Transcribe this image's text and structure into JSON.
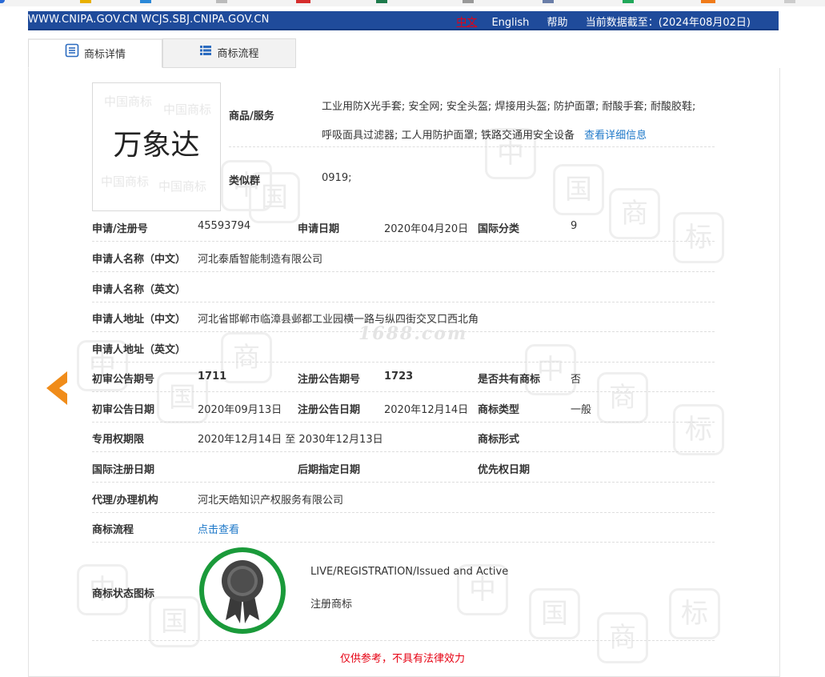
{
  "header": {
    "domains": "WWW.CNIPA.GOV.CN WCJS.SBJ.CNIPA.GOV.CN",
    "lang_zh": "中文",
    "lang_en": "English",
    "help": "帮助",
    "data_date": "当前数据截至：(2024年08月02日)"
  },
  "tabs": {
    "detail": "商标详情",
    "flow": "商标流程"
  },
  "logo": {
    "text": "万象达",
    "watermark": "中国商标"
  },
  "watermark": {
    "chars": [
      "中",
      "国",
      "商",
      "标"
    ],
    "site": "1688.com"
  },
  "goods": {
    "label": "商品/服务",
    "text": "工业用防X光手套; 安全网; 安全头盔; 焊接用头盔; 防护面罩; 耐酸手套; 耐酸胶鞋; 呼吸面具过滤器; 工人用防护面罩; 铁路交通用安全设备",
    "more_link": "查看详细信息"
  },
  "similar_group": {
    "label": "类似群",
    "value": "0919;"
  },
  "fields": {
    "reg_no_label": "申请/注册号",
    "reg_no": "45593794",
    "app_date_label": "申请日期",
    "app_date": "2020年04月20日",
    "intl_class_label": "国际分类",
    "intl_class": "9",
    "applicant_cn_label": "申请人名称（中文）",
    "applicant_cn": "河北泰盾智能制造有限公司",
    "applicant_en_label": "申请人名称（英文）",
    "applicant_en": "",
    "address_cn_label": "申请人地址（中文）",
    "address_cn": "河北省邯郸市临漳县邺都工业园横一路与纵四街交叉口西北角",
    "address_en_label": "申请人地址（英文）",
    "address_en": "",
    "prelim_issue_label": "初审公告期号",
    "prelim_issue": "1711",
    "reg_issue_label": "注册公告期号",
    "reg_issue": "1723",
    "shared_label": "是否共有商标",
    "shared": "否",
    "prelim_date_label": "初审公告日期",
    "prelim_date": "2020年09月13日",
    "reg_date_label": "注册公告日期",
    "reg_date": "2020年12月14日",
    "tm_type_label": "商标类型",
    "tm_type": "一般",
    "exclusive_label": "专用权期限",
    "exclusive": "2020年12月14日 至 2030年12月13日",
    "tm_form_label": "商标形式",
    "tm_form": "",
    "intl_reg_label": "国际注册日期",
    "intl_reg": "",
    "later_label": "后期指定日期",
    "later": "",
    "priority_label": "优先权日期",
    "priority": "",
    "agent_label": "代理/办理机构",
    "agent": "河北天皓知识产权服务有限公司",
    "flow_label": "商标流程",
    "flow_link": "点击查看"
  },
  "status": {
    "label": "商标状态图标",
    "en": "LIVE/REGISTRATION/Issued and Active",
    "cn": "注册商标"
  },
  "disclaimer": "仅供参考，不具有法律效力",
  "colors": {
    "header": "#1f4b9b",
    "link": "#1f79c9",
    "accent": "#e60012",
    "arrow": "#f08c1a",
    "badge_ring": "#1a9a3a"
  },
  "icons": {
    "detail_tab": "document-icon",
    "flow_tab": "list-icon",
    "prev": "left-arrow-icon",
    "status": "ribbon-badge-icon"
  }
}
